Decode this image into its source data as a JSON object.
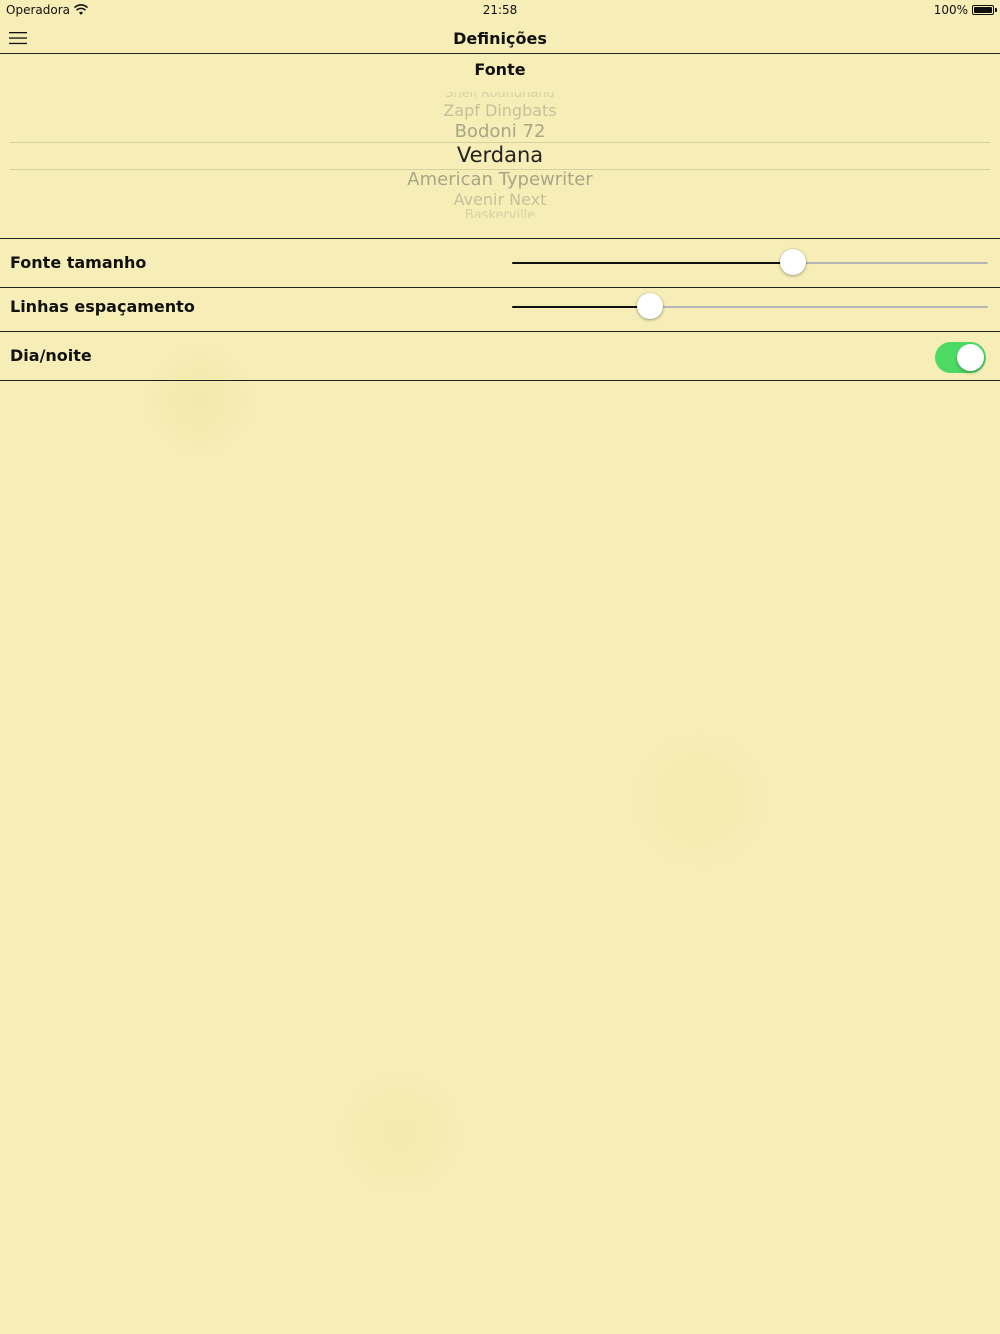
{
  "status_bar": {
    "carrier": "Operadora",
    "time": "21:58",
    "battery": "100%",
    "battery_level": 1.0
  },
  "nav": {
    "title": "Definições",
    "menu_icon": "hamburger-menu-icon"
  },
  "font_picker": {
    "title": "Fonte",
    "items": [
      "Snell Roundhand",
      "Zapf Dingbats",
      "Bodoni 72",
      "Verdana",
      "American Typewriter",
      "Avenir Next",
      "Baskerville"
    ],
    "selected": "Verdana"
  },
  "settings": {
    "font_size": {
      "label": "Fonte tamanho",
      "value": 0.59
    },
    "line_spacing": {
      "label": "Linhas espaçamento",
      "value": 0.29
    },
    "day_night": {
      "label": "Dia/noite",
      "on": true
    }
  },
  "colors": {
    "background": "#f6eeb6",
    "toggle_on": "#4cd964",
    "slider_fill": "#111111",
    "slider_track": "#b5b5b5"
  }
}
